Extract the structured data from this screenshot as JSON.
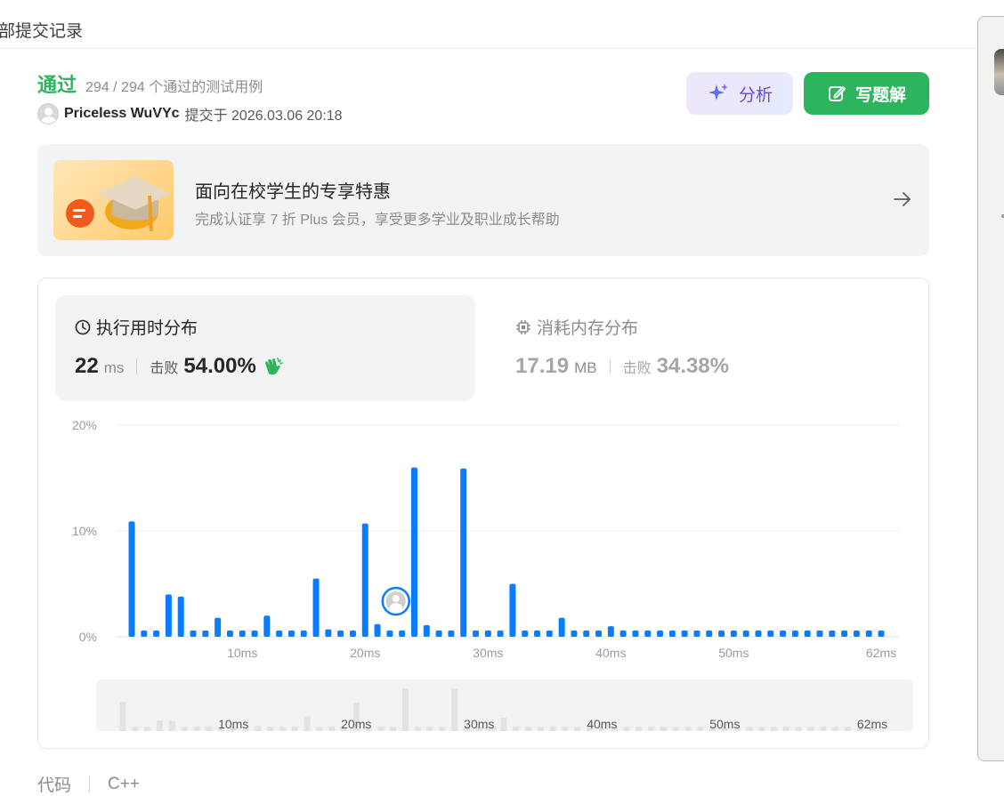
{
  "header": {
    "breadcrumb": "部提交记录"
  },
  "result": {
    "status": "通过",
    "cases": "294 / 294 个通过的测试用例",
    "username": "Priceless WuVYc",
    "submit_text": "提交于 2026.03.06 20:18"
  },
  "actions": {
    "analyze_label": "分析",
    "write_solution_label": "写题解"
  },
  "promo": {
    "title": "面向在校学生的专享特惠",
    "subtitle": "完成认证享 7 折 Plus 会员，享受更多学业及职业成长帮助"
  },
  "stats": {
    "runtime": {
      "title": "执行用时分布",
      "value": "22",
      "unit": "ms",
      "beat_label": "击败",
      "beat_pct": "54.00%"
    },
    "memory": {
      "title": "消耗内存分布",
      "value": "17.19",
      "unit": "MB",
      "beat_label": "击败",
      "beat_pct": "34.38%"
    }
  },
  "code": {
    "label": "代码",
    "language": "C++"
  },
  "colors": {
    "accent_green": "#2db55d",
    "bar_blue": "#0a7cff",
    "mini_bar": "#e3e3e3"
  },
  "chart_data": {
    "type": "bar",
    "x": [
      1,
      2,
      3,
      4,
      5,
      6,
      7,
      8,
      9,
      10,
      11,
      12,
      13,
      14,
      15,
      16,
      17,
      18,
      19,
      20,
      21,
      22,
      23,
      24,
      25,
      26,
      27,
      28,
      29,
      30,
      31,
      32,
      33,
      34,
      35,
      36,
      37,
      38,
      39,
      40,
      41,
      42,
      43,
      44,
      45,
      46,
      47,
      48,
      49,
      50,
      51,
      52,
      53,
      54,
      55,
      56,
      57,
      58,
      59,
      60,
      61,
      62
    ],
    "values": [
      10.9,
      0.6,
      0.6,
      4.0,
      3.8,
      0.6,
      0.6,
      1.8,
      0.6,
      0.6,
      0.6,
      2.0,
      0.6,
      0.6,
      0.6,
      5.5,
      0.7,
      0.6,
      0.6,
      10.7,
      1.2,
      0.6,
      0.6,
      16.0,
      1.1,
      0.6,
      0.6,
      15.9,
      0.6,
      0.6,
      0.6,
      5.0,
      0.6,
      0.6,
      0.6,
      1.8,
      0.6,
      0.6,
      0.6,
      1.0,
      0.6,
      0.6,
      0.6,
      0.6,
      0.6,
      0.6,
      0.6,
      0.6,
      0.6,
      0.6,
      0.6,
      0.6,
      0.6,
      0.6,
      0.6,
      0.6,
      0.6,
      0.6,
      0.6,
      0.6,
      0.6,
      0.6
    ],
    "x_ticks": [
      10,
      20,
      30,
      40,
      50,
      62
    ],
    "x_tick_labels": [
      "10ms",
      "20ms",
      "30ms",
      "40ms",
      "50ms",
      "62ms"
    ],
    "y_ticks": [
      0,
      10,
      20
    ],
    "y_tick_labels": [
      "0%",
      "10%",
      "20%"
    ],
    "ylim": [
      0,
      20
    ],
    "grid": true,
    "marker_x": 23
  }
}
